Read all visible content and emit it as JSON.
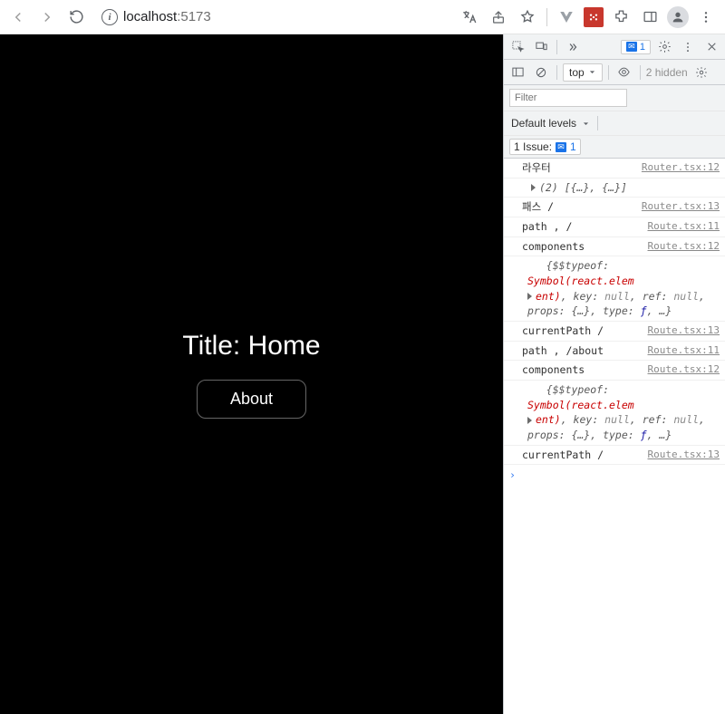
{
  "browser": {
    "url_host": "localhost",
    "url_port": ":5173"
  },
  "page": {
    "title": "Title: Home",
    "about_btn": "About"
  },
  "devtools": {
    "tabbar_badge_count": "1",
    "context": "top",
    "hidden": "2 hidden",
    "filter_placeholder": "Filter",
    "levels": "Default levels",
    "issue_label": "1 Issue:",
    "issue_count": "1",
    "logs": [
      {
        "msg": "라우터",
        "src": "Router.tsx:12"
      },
      {
        "sub": true,
        "arrow": true,
        "ital": "(2) [{…}, {…}]"
      },
      {
        "msg": "패스  /",
        "src": "Router.tsx:13"
      },
      {
        "msg": "path , /",
        "src": "Route.tsx:11"
      },
      {
        "msg": "components",
        "src": "Route.tsx:12"
      },
      {
        "sub": true,
        "obj_pre": "{$$typeof: ",
        "sym": "Symbol(react.elem",
        "row2_pre": "ent)",
        "row2": ", key: ",
        "null1": "null",
        "row2b": ", ref: ",
        "null2": "null",
        "row2c": ", props: {…}, type: ",
        "f": "ƒ",
        "row2d": ", …}",
        "arrow": true
      },
      {
        "msg": "currentPath  /",
        "src": "Route.tsx:13"
      },
      {
        "msg": "path , /about",
        "src": "Route.tsx:11"
      },
      {
        "msg": "components",
        "src": "Route.tsx:12"
      },
      {
        "sub": true,
        "obj_pre": "{$$typeof: ",
        "sym": "Symbol(react.elem",
        "row2_pre": "ent)",
        "row2": ", key: ",
        "null1": "null",
        "row2b": ", ref: ",
        "null2": "null",
        "row2c": ", props: {…}, type: ",
        "f": "ƒ",
        "row2d": ", …}",
        "arrow": true
      },
      {
        "msg": "currentPath  /",
        "src": "Route.tsx:13"
      }
    ],
    "prompt": "›"
  }
}
